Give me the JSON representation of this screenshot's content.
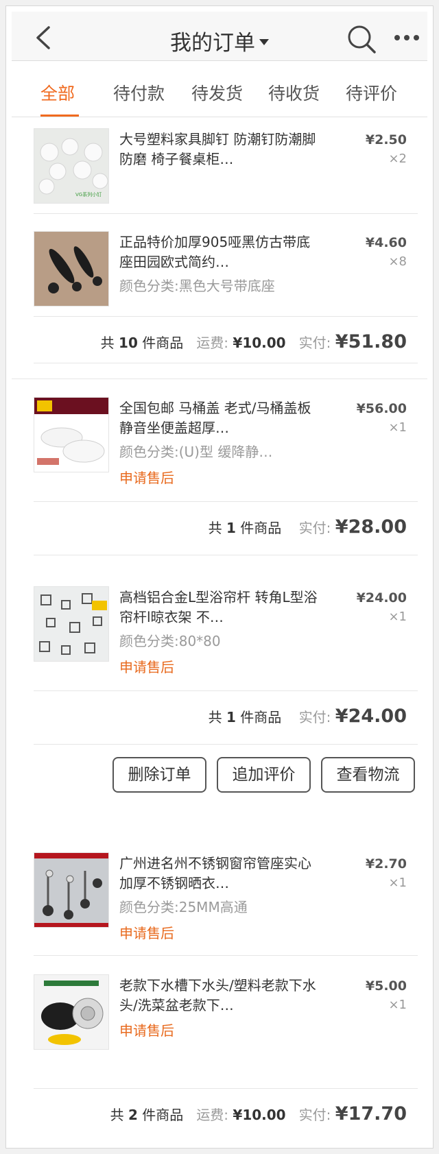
{
  "header": {
    "title": "我的订单",
    "back_icon": "chevron-left-icon",
    "search_icon": "search-icon",
    "more_icon": "more-horizontal-icon"
  },
  "tabs": [
    {
      "label": "全部",
      "active": true
    },
    {
      "label": "待付款",
      "active": false
    },
    {
      "label": "待发货",
      "active": false
    },
    {
      "label": "待收货",
      "active": false
    },
    {
      "label": "待评价",
      "active": false
    }
  ],
  "colors": {
    "accent": "#f06a1f",
    "after_sale": "#e86a1e"
  },
  "orders": [
    {
      "items": [
        {
          "name": "大号塑料家具脚钉 防潮钉防潮脚防磨 椅子餐桌柜…",
          "spec": "",
          "price": "¥2.50",
          "qty": "×2",
          "thumb_caption": "VG系列小钉"
        },
        {
          "name": "正品特价加厚905哑黑仿古带底座田园欧式简约…",
          "spec": "颜色分类:黑色大号带底座",
          "price": "¥4.60",
          "qty": "×8"
        }
      ],
      "summary": {
        "count_prefix": "共",
        "count": "10",
        "count_suffix": "件商品",
        "shipping_label": "运费:",
        "shipping": "¥10.00",
        "paid_label": "实付:",
        "paid": "¥51.80"
      }
    },
    {
      "items": [
        {
          "name": "全国包邮 马桶盖 老式/马桶盖板 静音坐便盖超厚…",
          "spec": "颜色分类:(U)型 缓降静…",
          "price": "¥56.00",
          "qty": "×1",
          "after_sale": "申请售后"
        }
      ],
      "summary": {
        "count_prefix": "共",
        "count": "1",
        "count_suffix": "件商品",
        "paid_label": "实付:",
        "paid": "¥28.00"
      }
    },
    {
      "items": [
        {
          "name": "高档铝合金L型浴帘杆 转角L型浴帘杆l晾衣架 不…",
          "spec": "颜色分类:80*80",
          "price": "¥24.00",
          "qty": "×1",
          "after_sale": "申请售后"
        }
      ],
      "summary": {
        "count_prefix": "共",
        "count": "1",
        "count_suffix": "件商品",
        "paid_label": "实付:",
        "paid": "¥24.00"
      },
      "actions": [
        "删除订单",
        "追加评价",
        "查看物流"
      ]
    },
    {
      "items": [
        {
          "name": "广州进名州不锈钢窗帘管座实心加厚不锈钢晒衣…",
          "spec": "颜色分类:25MM高通",
          "price": "¥2.70",
          "qty": "×1",
          "after_sale": "申请售后"
        },
        {
          "name": "老款下水槽下水头/塑料老款下水头/洗菜盆老款下…",
          "spec": "",
          "price": "¥5.00",
          "qty": "×1",
          "after_sale": "申请售后"
        }
      ],
      "summary": {
        "count_prefix": "共",
        "count": "2",
        "count_suffix": "件商品",
        "shipping_label": "运费:",
        "shipping": "¥10.00",
        "paid_label": "实付:",
        "paid": "¥17.70"
      }
    }
  ]
}
